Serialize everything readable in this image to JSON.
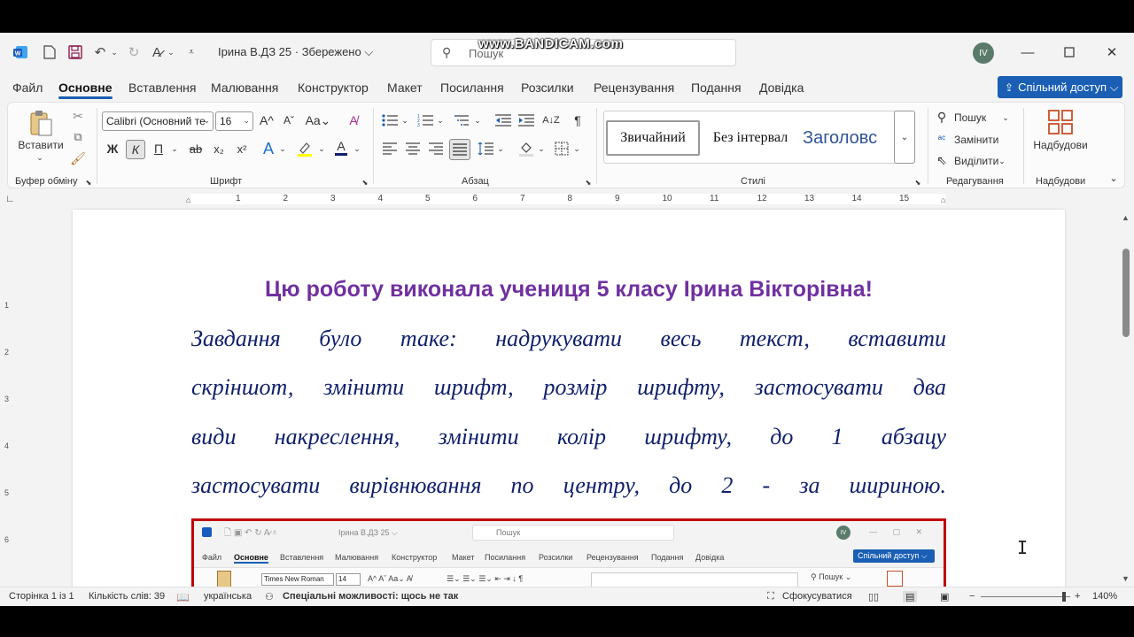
{
  "titlebar": {
    "doc_title": "Ірина В.ДЗ 25 · Збережено ⌵",
    "search_placeholder": "Пошук",
    "watermark": "www.BANDICAM.com",
    "avatar_initials": "IV"
  },
  "tabs": [
    "Файл",
    "Основне",
    "Вставлення",
    "Малювання",
    "Конструктор",
    "Макет",
    "Посилання",
    "Розсилки",
    "Рецензування",
    "Подання",
    "Довідка"
  ],
  "active_tab": "Основне",
  "share_label": "Спільний доступ ⌵",
  "ribbon": {
    "clipboard": {
      "paste_label": "Вставити",
      "group_label": "Буфер обміну"
    },
    "font": {
      "font_name": "Calibri (Основний те",
      "font_size": "16",
      "group_label": "Шрифт"
    },
    "paragraph": {
      "group_label": "Абзац"
    },
    "styles": {
      "items": [
        "Звичайний",
        "Без інтервал",
        "Заголовс"
      ],
      "group_label": "Стилі"
    },
    "editing": {
      "find": "Пошук",
      "replace": "Замінити",
      "select": "Виділити",
      "group_label": "Редагування"
    },
    "addins": {
      "label": "Надбудови",
      "group_label": "Надбудови"
    }
  },
  "ruler_numbers": [
    "1",
    "2",
    "3",
    "4",
    "5",
    "6",
    "7",
    "8",
    "9",
    "10",
    "11",
    "12",
    "13",
    "14",
    "15"
  ],
  "vruler_numbers": [
    "1",
    "2",
    "3",
    "4",
    "5",
    "6"
  ],
  "document": {
    "heading": "Цю роботу виконала учениця 5 класу Ірина Вікторівна!",
    "lines": [
      "Завдання було таке: надрукувати весь текст, вставити",
      "скріншот, змінити шрифт, розмір шрифту, застосувати два",
      "види накреслення, змінити колір шрифту, до 1 абзацу",
      "застосувати вирівнювання по центру, до 2 - за шириною."
    ]
  },
  "embedded_shot": {
    "title": "Ірина В.ДЗ 25 ⌵",
    "search": "Пошук",
    "avatar": "IV",
    "tabs": [
      "Файл",
      "Основне",
      "Вставлення",
      "Малювання",
      "Конструктор",
      "Макет",
      "Посилання",
      "Розсилки",
      "Рецензування",
      "Подання",
      "Довідка"
    ],
    "share": "Спільний доступ ⌵",
    "font_name": "Times New Roman",
    "font_size": "14",
    "find": "Пошук"
  },
  "status": {
    "page": "Сторінка 1 із 1",
    "words": "Кількість слів: 39",
    "language": "українська",
    "accessibility": "Спеціальні можливості: щось не так",
    "focus": "Сфокусуватися",
    "zoom": "140%",
    "zoom_level_percent": 140
  },
  "colors": {
    "heading": "#7030a0",
    "body_text": "#0f1f6b",
    "accent": "#1a5fb4",
    "screenshot_border": "#c00000"
  }
}
